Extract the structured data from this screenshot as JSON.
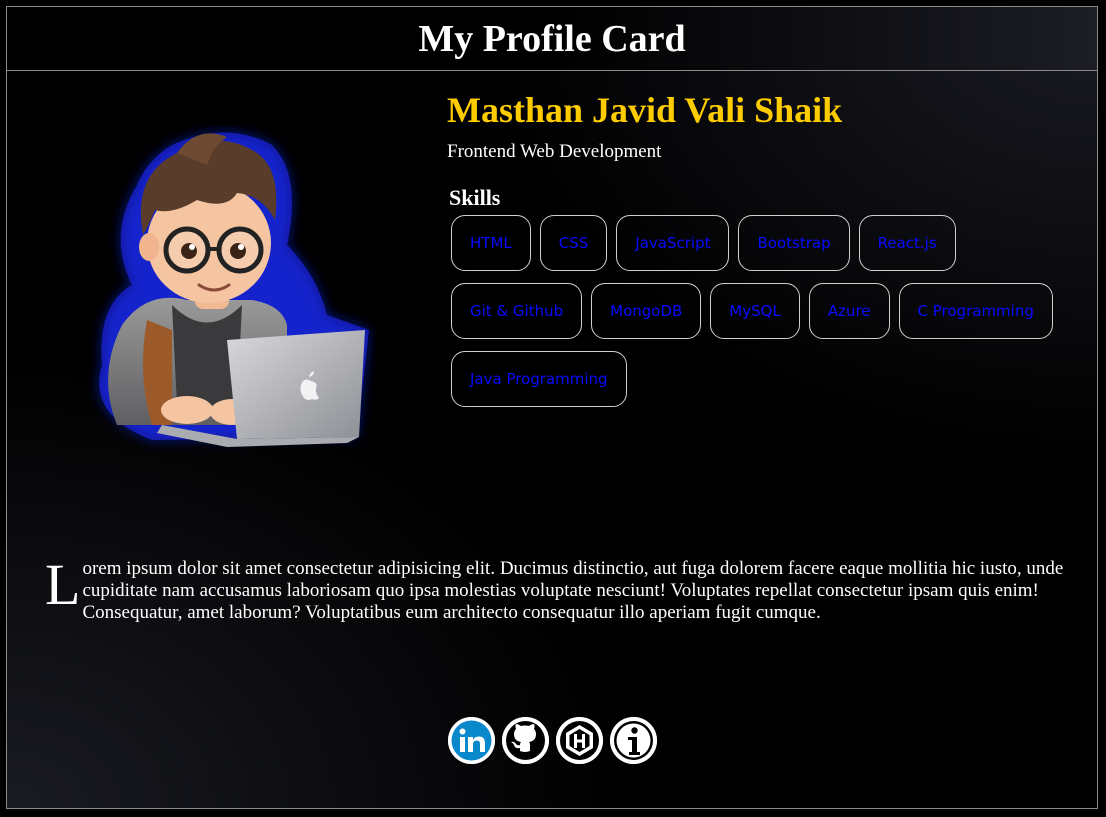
{
  "header": {
    "title": "My Profile Card"
  },
  "profile": {
    "name": "Masthan Javid Vali Shaik",
    "role": "Frontend Web Development",
    "avatar_icon": "developer-avatar-illustration",
    "bio_first_letter": "L",
    "bio_rest": "orem ipsum dolor sit amet consectetur adipisicing elit. Ducimus distinctio, aut fuga dolorem facere eaque mollitia hic iusto, unde cupiditate nam accusamus laboriosam quo ipsa molestias voluptate nesciunt! Voluptates repellat consectetur ipsam quis enim! Consequatur, amet laborum? Voluptatibus eum architecto consequatur illo aperiam fugit cumque."
  },
  "skills": {
    "title": "Skills",
    "items": [
      "HTML",
      "CSS",
      "JavaScript",
      "Bootstrap",
      "React.js",
      "Git & Github",
      "MongoDB",
      "MySQL",
      "Azure",
      "C Programming",
      "Java Programming"
    ]
  },
  "socials": [
    {
      "icon": "linkedin-icon",
      "color": "#0a66c2"
    },
    {
      "icon": "github-icon",
      "color": "#ffffff"
    },
    {
      "icon": "hashnode-icon",
      "color": "#ffffff"
    },
    {
      "icon": "info-icon",
      "color": "#ffffff"
    }
  ],
  "colors": {
    "name": "#ffcc00",
    "chip_text": "#0a0aff",
    "avatar_glow": "#1a2bff"
  }
}
